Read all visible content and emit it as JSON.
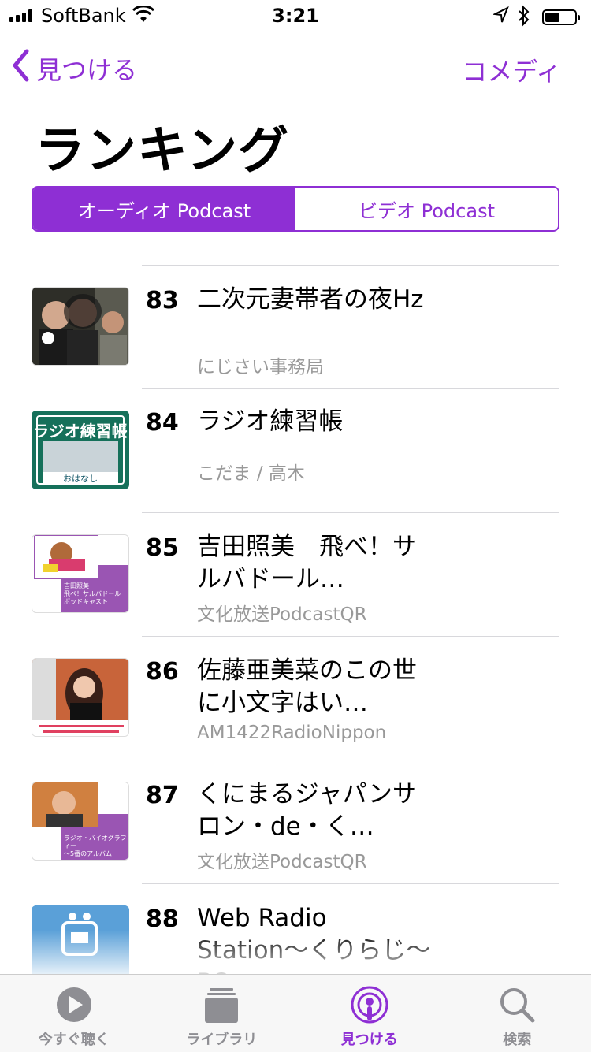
{
  "status": {
    "carrier": "SoftBank",
    "time": "3:21"
  },
  "nav": {
    "back_label": "見つける",
    "right_label": "コメディ"
  },
  "page": {
    "title": "ランキング"
  },
  "segments": {
    "audio": "オーディオ Podcast",
    "video": "ビデオ Podcast",
    "selected": "audio"
  },
  "items": [
    {
      "rank": "83",
      "name": "二次元妻帯者の夜Hz",
      "author": "にじさい事務局"
    },
    {
      "rank": "84",
      "name": "ラジオ練習帳",
      "author": "こだま / 高木"
    },
    {
      "rank": "85",
      "name": "吉田照美　飛べ！サルバドール…",
      "author": "文化放送PodcastQR"
    },
    {
      "rank": "86",
      "name": "佐藤亜美菜のこの世に小文字はい…",
      "author": "AM1422RadioNippon"
    },
    {
      "rank": "87",
      "name": "くにまるジャパンサロン・de・く…",
      "author": "文化放送PodcastQR"
    },
    {
      "rank": "88",
      "name": "Web Radio Station〜くりらじ〜PO…",
      "author": ""
    }
  ],
  "artwork_text": {
    "84": {
      "title": "ラジオ練習帳",
      "sub": "おはなし"
    },
    "85": {
      "line1": "吉田照美",
      "line2": "飛べ！サルバドール",
      "line3": "ポッドキャスト"
    },
    "87": {
      "line1": "ラジオ・バイオグラフィー",
      "line2": "〜5番のアルバム"
    }
  },
  "tabs": [
    {
      "label": "今すぐ聴く",
      "icon": "play-circle-icon"
    },
    {
      "label": "ライブラリ",
      "icon": "library-stack-icon"
    },
    {
      "label": "見つける",
      "icon": "podcast-icon",
      "active": true
    },
    {
      "label": "検索",
      "icon": "search-icon"
    }
  ],
  "colors": {
    "accent": "#8e2fd4",
    "secondary_text": "#999999"
  }
}
